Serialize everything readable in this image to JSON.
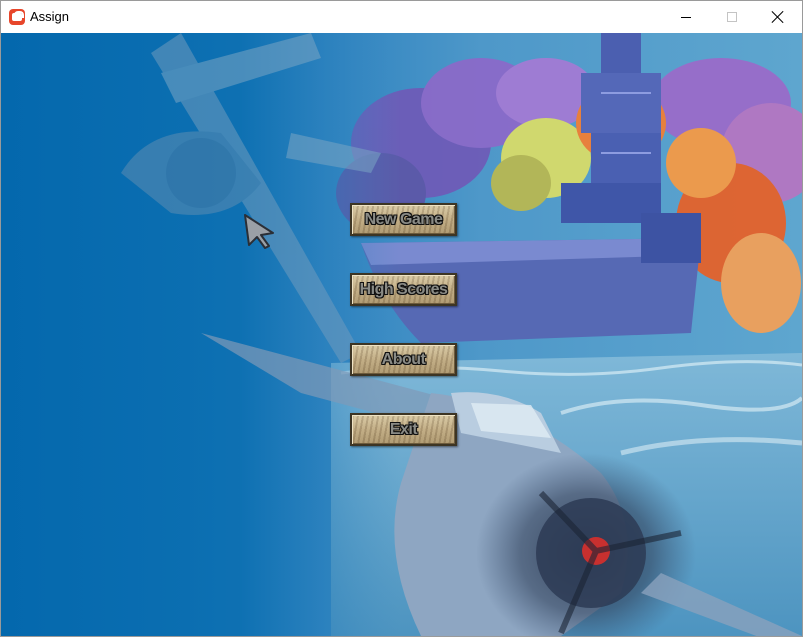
{
  "window": {
    "title": "Assign",
    "icon": "monogame-icon",
    "controls": [
      "minimize-icon",
      "maximize-icon",
      "close-icon"
    ]
  },
  "menu": {
    "new_game": "New Game",
    "high_scores": "High Scores",
    "about": "About",
    "exit": "Exit"
  },
  "colors": {
    "background_blue": "#0468ad",
    "button_wood": "#bba67e",
    "button_text": "#8a8b86",
    "smoke_purple": "#8a5fc8",
    "fire_orange": "#e0662a"
  },
  "scene": {
    "elements": [
      "fighter-plane-top",
      "aircraft-carrier",
      "explosion-clouds",
      "ocean-waves",
      "fighter-plane-bottom"
    ]
  }
}
